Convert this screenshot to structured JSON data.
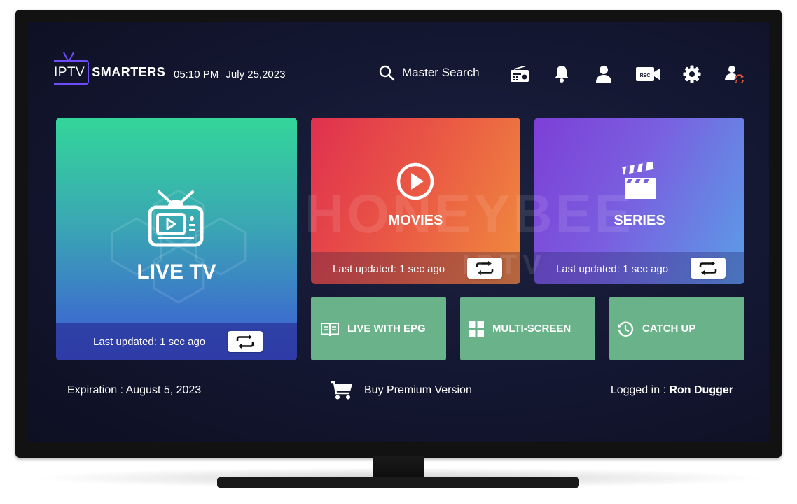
{
  "header": {
    "logo_prefix": "IPTV",
    "logo_word": "SMARTERS",
    "time": "05:10 PM",
    "date": "July 25,2023",
    "search_label": "Master Search",
    "icons": [
      "radio-icon",
      "bell-icon",
      "user-icon",
      "rec-icon",
      "gear-icon",
      "switch-user-icon"
    ],
    "rec_text": "REC"
  },
  "tiles": {
    "live": {
      "title": "LIVE TV",
      "updated": "Last updated: 1 sec ago"
    },
    "movies": {
      "title": "MOVIES",
      "updated": "Last updated: 1 sec ago"
    },
    "series": {
      "title": "SERIES",
      "updated": "Last updated: 1 sec ago"
    },
    "small": [
      {
        "label": "LIVE WITH EPG",
        "icon": "book-icon"
      },
      {
        "label": "MULTI-SCREEN",
        "icon": "grid-icon"
      },
      {
        "label": "CATCH UP",
        "icon": "history-icon"
      }
    ]
  },
  "footer": {
    "expiration": "Expiration : August 5, 2023",
    "buy_label": "Buy Premium Version",
    "logged_label": "Logged in :",
    "user_name": "Ron Dugger"
  },
  "watermark": {
    "text": "HONEYBEE",
    "subtext": "IPTV"
  },
  "colors": {
    "logo_accent": "#6d4df5",
    "small_tile": "#6ab38a",
    "screen_bg": "#141833"
  }
}
